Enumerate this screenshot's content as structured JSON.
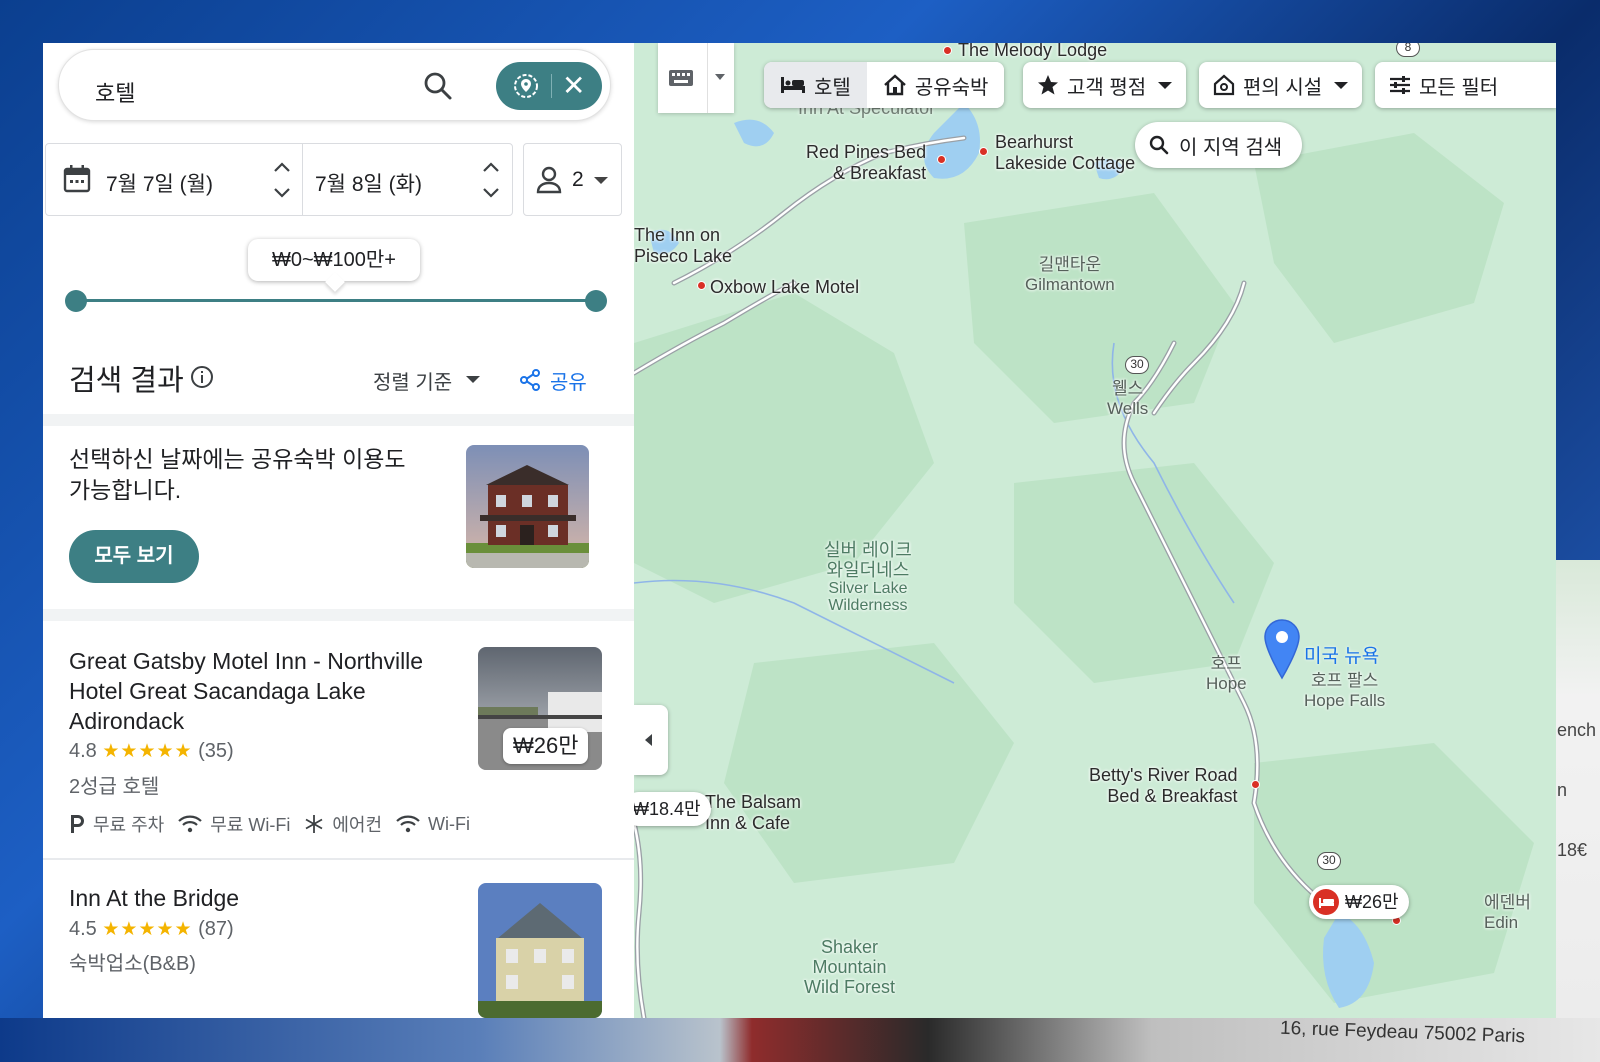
{
  "search": {
    "query": "호텔"
  },
  "dates": {
    "checkin": "7월 7일 (월)",
    "checkout": "7월 8일 (화)"
  },
  "guests": {
    "count": "2"
  },
  "price_range": {
    "label": "₩0~₩100만+",
    "min_fraction": 0.0,
    "max_fraction": 1.0
  },
  "results": {
    "title": "검색 결과",
    "sort_label": "정렬 기준",
    "share_label": "공유"
  },
  "promo": {
    "text": "선택하신 날짜에는 공유숙박 이용도 가능합니다.",
    "button_label": "모두 보기"
  },
  "hotels": [
    {
      "name": "Great Gatsby Motel Inn - Northville Hotel Great Sacandaga Lake Adirondack",
      "rating": "4.8",
      "stars": "★★★★★",
      "reviews": "(35)",
      "type": "2성급 호텔",
      "price": "₩26만",
      "amenities": [
        "무료 주차",
        "무료 Wi-Fi",
        "에어컨",
        "Wi-Fi"
      ]
    },
    {
      "name": "Inn At the Bridge",
      "rating": "4.5",
      "stars": "★★★★★",
      "reviews": "(87)",
      "type": "숙박업소(B&B)"
    }
  ],
  "map": {
    "chips": {
      "hotel": "호텔",
      "vacation": "공유숙박",
      "rating": "고객 평점",
      "amenities": "편의 시설",
      "all_filters": "모든 필터"
    },
    "area_search": "이 지역 검색",
    "labels": {
      "melody_lodge": "The Melody Lodge",
      "inn_speculator": "Inn At Speculator",
      "red_pines_1": "Red Pines Bed",
      "red_pines_2": "& Breakfast",
      "bearhurst_1": "Bearhurst",
      "bearhurst_2": "Lakeside Cottage",
      "inn_piseco_1": "The Inn on",
      "inn_piseco_2": "Piseco Lake",
      "oxbow": "Oxbow Lake Motel",
      "gilmantown_ko": "길맨타운",
      "gilmantown_en": "Gilmantown",
      "wells_ko": "웰스",
      "wells_en": "Wells",
      "silver_ko_1": "실버 레이크",
      "silver_ko_2": "와일더네스",
      "silver_en_1": "Silver Lake",
      "silver_en_2": "Wilderness",
      "hope_ko": "호프",
      "hope_en": "Hope",
      "location": "미국 뉴욕",
      "hope_falls_ko": "호프 팔스",
      "hope_falls_en": "Hope Falls",
      "bettys_1": "Betty's River Road",
      "bettys_2": "Bed & Breakfast",
      "balsam_1": "The Balsam",
      "balsam_2": "Inn & Cafe",
      "shaker_1": "Shaker",
      "shaker_2": "Mountain",
      "shaker_3": "Wild Forest",
      "edinburg_ko": "에덴버",
      "edinburg_en": "Edin"
    },
    "route_shields": [
      "8",
      "30",
      "30"
    ],
    "price_pins": {
      "balsam": "₩18.4만",
      "gatsby": "₩26만"
    }
  },
  "background": {
    "address": "16, rue Feydeau 75002 Paris",
    "side_texts": [
      "ench",
      "n 18€"
    ]
  },
  "colors": {
    "accent": "#3d7f84",
    "map_bg": "#cdebd6",
    "poi": "#d93025",
    "link": "#1a73e8"
  }
}
